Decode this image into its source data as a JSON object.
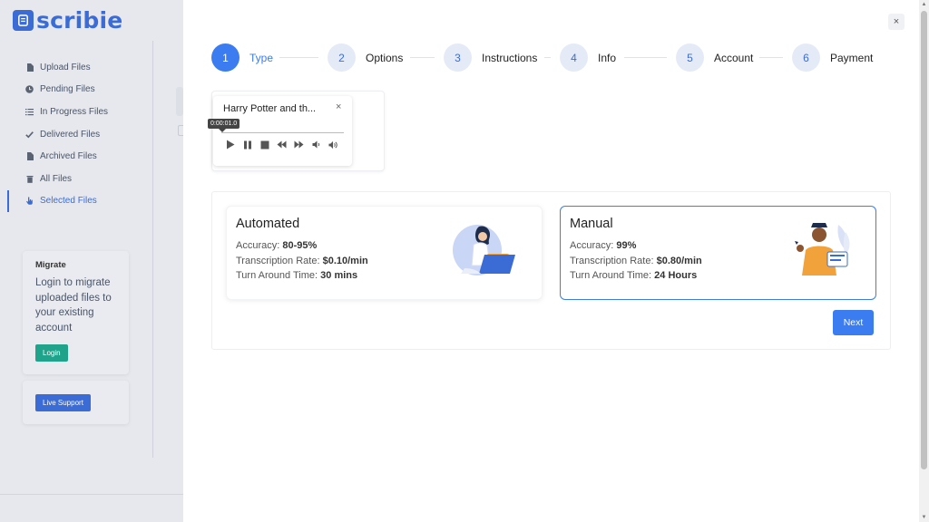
{
  "sidebar": {
    "brand": "scribie",
    "items": [
      {
        "label": "Upload Files",
        "icon": "file-icon"
      },
      {
        "label": "Pending Files",
        "icon": "clock-icon"
      },
      {
        "label": "In Progress Files",
        "icon": "list-icon"
      },
      {
        "label": "Delivered Files",
        "icon": "check-icon"
      },
      {
        "label": "Archived Files",
        "icon": "file-icon"
      },
      {
        "label": "All Files",
        "icon": "trash-icon"
      },
      {
        "label": "Selected Files",
        "icon": "hand-pointer-icon"
      }
    ],
    "migrate": {
      "heading": "Migrate",
      "text": "Login to migrate uploaded files to your existing account",
      "button": "Login"
    },
    "support_button": "Live Support"
  },
  "modal": {
    "close_label": "×",
    "steps": [
      {
        "num": "1",
        "label": "Type",
        "active": true
      },
      {
        "num": "2",
        "label": "Options"
      },
      {
        "num": "3",
        "label": "Instructions"
      },
      {
        "num": "4",
        "label": "Info"
      },
      {
        "num": "5",
        "label": "Account"
      },
      {
        "num": "6",
        "label": "Payment"
      }
    ],
    "player": {
      "title": "Harry Potter and th...",
      "close": "×",
      "time_tooltip": "0:00:01.0"
    },
    "options": {
      "automated": {
        "title": "Automated",
        "accuracy_label": "Accuracy:",
        "accuracy_value": "80-95%",
        "rate_label": "Transcription Rate:",
        "rate_value": "$0.10/min",
        "tat_label": "Turn Around Time:",
        "tat_value": "30 mins"
      },
      "manual": {
        "title": "Manual",
        "accuracy_label": "Accuracy:",
        "accuracy_value": "99%",
        "rate_label": "Transcription Rate:",
        "rate_value": "$0.80/min",
        "tat_label": "Turn Around Time:",
        "tat_value": "24 Hours"
      }
    },
    "next_button": "Next"
  },
  "colors": {
    "primary": "#3b7cf0",
    "brand": "#3b6cd6",
    "login_green": "#1fa38a"
  }
}
